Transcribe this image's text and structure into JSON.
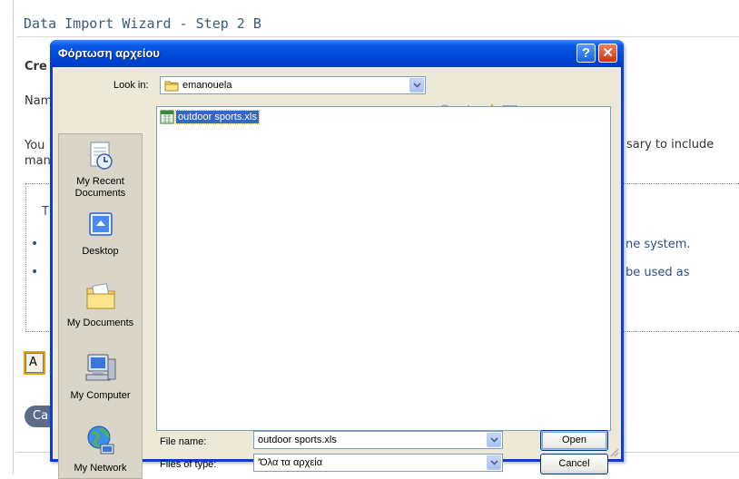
{
  "background_page": {
    "title": "Data Import Wizard - Step 2 B",
    "heading_fragment": "Cre",
    "name_fragment": "Nam",
    "you_fragment": "You",
    "man_fragment": "man",
    "right_text_1": "sary to include",
    "tips_fragment": "T",
    "bullet_text_1": "ne system.",
    "bullet_text_2": "be used as",
    "button_a_label": "A",
    "button_ca_label": "Ca"
  },
  "dialog": {
    "title": "Φόρτωση αρχείου",
    "help_glyph": "?",
    "close_glyph": "✕",
    "look_in_label": "Look in:",
    "look_in_value": "emanouela",
    "places": [
      {
        "label": "My Recent Documents",
        "icon": "recent-documents-icon"
      },
      {
        "label": "Desktop",
        "icon": "desktop-icon"
      },
      {
        "label": "My Documents",
        "icon": "my-documents-icon"
      },
      {
        "label": "My Computer",
        "icon": "my-computer-icon"
      },
      {
        "label": "My Network",
        "icon": "my-network-icon"
      }
    ],
    "place_labels": {
      "recent_line1": "My Recent",
      "recent_line2": "Documents",
      "desktop": "Desktop",
      "documents": "My Documents",
      "computer": "My Computer",
      "network": "My Network"
    },
    "files": [
      {
        "name": "outdoor sports.xls",
        "icon": "excel-file-icon",
        "selected": true
      }
    ],
    "file_name_label": "File name:",
    "file_name_value": "outdoor sports.xls",
    "file_type_label": "Files of type:",
    "file_type_value": "'Όλα τα αρχεία",
    "open_button": "Open",
    "cancel_button": "Cancel",
    "toolbar_icons": [
      "back-icon",
      "up-folder-icon",
      "new-folder-icon",
      "views-menu-icon"
    ]
  },
  "colors": {
    "titlebar": "#0048d8",
    "dialog_face": "#ece9d8",
    "selection": "#316ac5",
    "page_title": "#3b5a7a"
  }
}
